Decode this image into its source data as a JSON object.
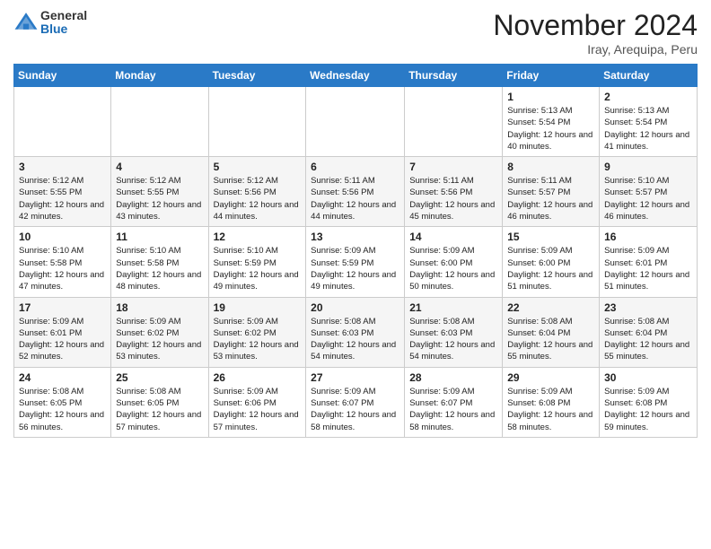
{
  "header": {
    "logo_general": "General",
    "logo_blue": "Blue",
    "month_title": "November 2024",
    "location": "Iray, Arequipa, Peru"
  },
  "days_of_week": [
    "Sunday",
    "Monday",
    "Tuesday",
    "Wednesday",
    "Thursday",
    "Friday",
    "Saturday"
  ],
  "weeks": [
    [
      {
        "day": "",
        "info": ""
      },
      {
        "day": "",
        "info": ""
      },
      {
        "day": "",
        "info": ""
      },
      {
        "day": "",
        "info": ""
      },
      {
        "day": "",
        "info": ""
      },
      {
        "day": "1",
        "info": "Sunrise: 5:13 AM\nSunset: 5:54 PM\nDaylight: 12 hours and 40 minutes."
      },
      {
        "day": "2",
        "info": "Sunrise: 5:13 AM\nSunset: 5:54 PM\nDaylight: 12 hours and 41 minutes."
      }
    ],
    [
      {
        "day": "3",
        "info": "Sunrise: 5:12 AM\nSunset: 5:55 PM\nDaylight: 12 hours and 42 minutes."
      },
      {
        "day": "4",
        "info": "Sunrise: 5:12 AM\nSunset: 5:55 PM\nDaylight: 12 hours and 43 minutes."
      },
      {
        "day": "5",
        "info": "Sunrise: 5:12 AM\nSunset: 5:56 PM\nDaylight: 12 hours and 44 minutes."
      },
      {
        "day": "6",
        "info": "Sunrise: 5:11 AM\nSunset: 5:56 PM\nDaylight: 12 hours and 44 minutes."
      },
      {
        "day": "7",
        "info": "Sunrise: 5:11 AM\nSunset: 5:56 PM\nDaylight: 12 hours and 45 minutes."
      },
      {
        "day": "8",
        "info": "Sunrise: 5:11 AM\nSunset: 5:57 PM\nDaylight: 12 hours and 46 minutes."
      },
      {
        "day": "9",
        "info": "Sunrise: 5:10 AM\nSunset: 5:57 PM\nDaylight: 12 hours and 46 minutes."
      }
    ],
    [
      {
        "day": "10",
        "info": "Sunrise: 5:10 AM\nSunset: 5:58 PM\nDaylight: 12 hours and 47 minutes."
      },
      {
        "day": "11",
        "info": "Sunrise: 5:10 AM\nSunset: 5:58 PM\nDaylight: 12 hours and 48 minutes."
      },
      {
        "day": "12",
        "info": "Sunrise: 5:10 AM\nSunset: 5:59 PM\nDaylight: 12 hours and 49 minutes."
      },
      {
        "day": "13",
        "info": "Sunrise: 5:09 AM\nSunset: 5:59 PM\nDaylight: 12 hours and 49 minutes."
      },
      {
        "day": "14",
        "info": "Sunrise: 5:09 AM\nSunset: 6:00 PM\nDaylight: 12 hours and 50 minutes."
      },
      {
        "day": "15",
        "info": "Sunrise: 5:09 AM\nSunset: 6:00 PM\nDaylight: 12 hours and 51 minutes."
      },
      {
        "day": "16",
        "info": "Sunrise: 5:09 AM\nSunset: 6:01 PM\nDaylight: 12 hours and 51 minutes."
      }
    ],
    [
      {
        "day": "17",
        "info": "Sunrise: 5:09 AM\nSunset: 6:01 PM\nDaylight: 12 hours and 52 minutes."
      },
      {
        "day": "18",
        "info": "Sunrise: 5:09 AM\nSunset: 6:02 PM\nDaylight: 12 hours and 53 minutes."
      },
      {
        "day": "19",
        "info": "Sunrise: 5:09 AM\nSunset: 6:02 PM\nDaylight: 12 hours and 53 minutes."
      },
      {
        "day": "20",
        "info": "Sunrise: 5:08 AM\nSunset: 6:03 PM\nDaylight: 12 hours and 54 minutes."
      },
      {
        "day": "21",
        "info": "Sunrise: 5:08 AM\nSunset: 6:03 PM\nDaylight: 12 hours and 54 minutes."
      },
      {
        "day": "22",
        "info": "Sunrise: 5:08 AM\nSunset: 6:04 PM\nDaylight: 12 hours and 55 minutes."
      },
      {
        "day": "23",
        "info": "Sunrise: 5:08 AM\nSunset: 6:04 PM\nDaylight: 12 hours and 55 minutes."
      }
    ],
    [
      {
        "day": "24",
        "info": "Sunrise: 5:08 AM\nSunset: 6:05 PM\nDaylight: 12 hours and 56 minutes."
      },
      {
        "day": "25",
        "info": "Sunrise: 5:08 AM\nSunset: 6:05 PM\nDaylight: 12 hours and 57 minutes."
      },
      {
        "day": "26",
        "info": "Sunrise: 5:09 AM\nSunset: 6:06 PM\nDaylight: 12 hours and 57 minutes."
      },
      {
        "day": "27",
        "info": "Sunrise: 5:09 AM\nSunset: 6:07 PM\nDaylight: 12 hours and 58 minutes."
      },
      {
        "day": "28",
        "info": "Sunrise: 5:09 AM\nSunset: 6:07 PM\nDaylight: 12 hours and 58 minutes."
      },
      {
        "day": "29",
        "info": "Sunrise: 5:09 AM\nSunset: 6:08 PM\nDaylight: 12 hours and 58 minutes."
      },
      {
        "day": "30",
        "info": "Sunrise: 5:09 AM\nSunset: 6:08 PM\nDaylight: 12 hours and 59 minutes."
      }
    ]
  ]
}
